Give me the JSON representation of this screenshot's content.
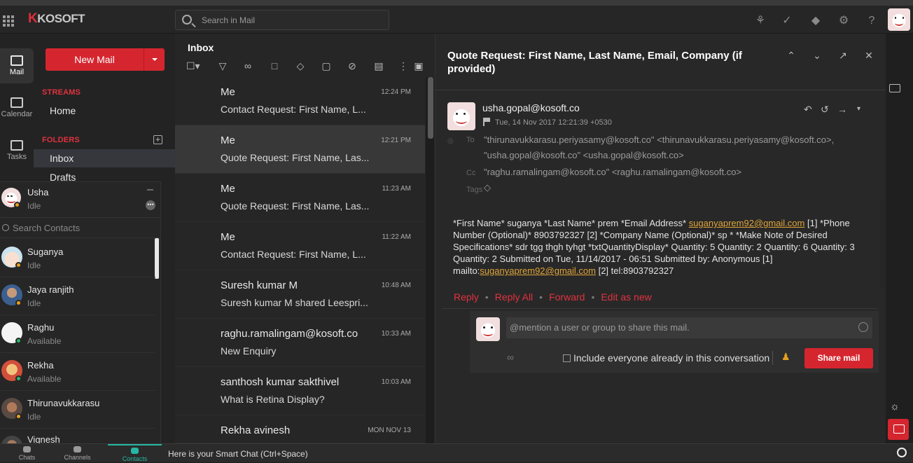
{
  "topbar": {
    "logo_k": "K",
    "logo_rest": "KOSOFT",
    "search_placeholder": "Search in Mail"
  },
  "rail": [
    {
      "label": "Mail",
      "icon": "mail-icon"
    },
    {
      "label": "Calendar",
      "icon": "calendar-icon"
    },
    {
      "label": "Tasks",
      "icon": "tasks-icon"
    }
  ],
  "folders": {
    "new_mail": "New Mail",
    "streams_head": "STREAMS",
    "home": "Home",
    "folders_head": "FOLDERS",
    "inbox": "Inbox",
    "drafts": "Drafts"
  },
  "contacts": {
    "me_name": "Usha",
    "me_status": "Idle",
    "search_placeholder": "Search Contacts",
    "list": [
      {
        "name": "Suganya",
        "status": "Idle",
        "dot": "#e6a01e"
      },
      {
        "name": "Jaya ranjith",
        "status": "Idle",
        "dot": "#e6a01e"
      },
      {
        "name": "Raghu",
        "status": "Available",
        "dot": "#27b66a"
      },
      {
        "name": "Rekha",
        "status": "Available",
        "dot": "#27b66a"
      },
      {
        "name": "Thirunavukkarasu",
        "status": "Idle",
        "dot": "#e6a01e"
      },
      {
        "name": "Vignesh",
        "status": "",
        "dot": "#e6a01e"
      }
    ]
  },
  "bottombar": {
    "tabs": [
      "Chats",
      "Channels",
      "Contacts"
    ],
    "smartchat": "Here is your Smart Chat (Ctrl+Space)"
  },
  "list": {
    "title": "Inbox",
    "messages": [
      {
        "from": "Me",
        "time": "12:24 PM",
        "subject": "Contact Request: First Name, L..."
      },
      {
        "from": "Me",
        "time": "12:21 PM",
        "subject": "Quote Request: First Name, Las..."
      },
      {
        "from": "Me",
        "time": "11:23 AM",
        "subject": "Quote Request: First Name, Las..."
      },
      {
        "from": "Me",
        "time": "11:22 AM",
        "subject": "Contact Request: First Name, L..."
      },
      {
        "from": "Suresh kumar M",
        "time": "10:48 AM",
        "subject": "Suresh kumar M shared Leespri..."
      },
      {
        "from": "raghu.ramalingam@kosoft.co",
        "time": "10:33 AM",
        "subject": "New Enquiry"
      },
      {
        "from": "santhosh kumar sakthivel",
        "time": "10:03 AM",
        "subject": "What is Retina Display?"
      },
      {
        "from": "Rekha avinesh",
        "time": "MON NOV 13",
        "subject": ""
      }
    ]
  },
  "reader": {
    "title": "Quote Request: First Name, Last Name, Email, Company (if provided)",
    "sender": "usha.gopal@kosoft.co",
    "date": "Tue, 14 Nov 2017 12:21:39 +0530",
    "to_label": "To",
    "to_line1": "\"thirunavukkarasu.periyasamy@kosoft.co\" <thirunavukkarasu.periyasamy@kosoft.co>,",
    "to_line2": "\"usha.gopal@kosoft.co\" <usha.gopal@kosoft.co>",
    "cc_label": "Cc",
    "cc_line": "\"raghu.ramalingam@kosoft.co\" <raghu.ramalingam@kosoft.co>",
    "tags_label": "Tags",
    "body_part1": "*First Name* suganya *Last Name* prem *Email Address* ",
    "body_link1": "suganyaprem92@gmail.com",
    "body_part2": " [1] *Phone Number (Optional)* 8903792327 [2] *Company Name (Optional)* sp *  *Make Note of Desired Specifications* sdr tgg thgh tyhgt *txtQuantityDisplay* Quantity: 5 Quantity: 2 Quantity: 6 Quantity: 3 Quantity: 2 Submitted on Tue, 11/14/2017 - 06:51 Submitted by: Anonymous [1] mailto:",
    "body_link2": "suganyaprem92@gmail.com",
    "body_part3": " [2] tel:8903792327",
    "actions": [
      "Reply",
      "Reply All",
      "Forward",
      "Edit as new"
    ],
    "mention_placeholder": "@mention a user or group to share this mail.",
    "include_label": "Include everyone already in this conversation",
    "share_button": "Share mail"
  },
  "colors": {
    "accent": "#d5262f",
    "link": "#e0a53a",
    "contacts_active": "#27b6a3"
  }
}
